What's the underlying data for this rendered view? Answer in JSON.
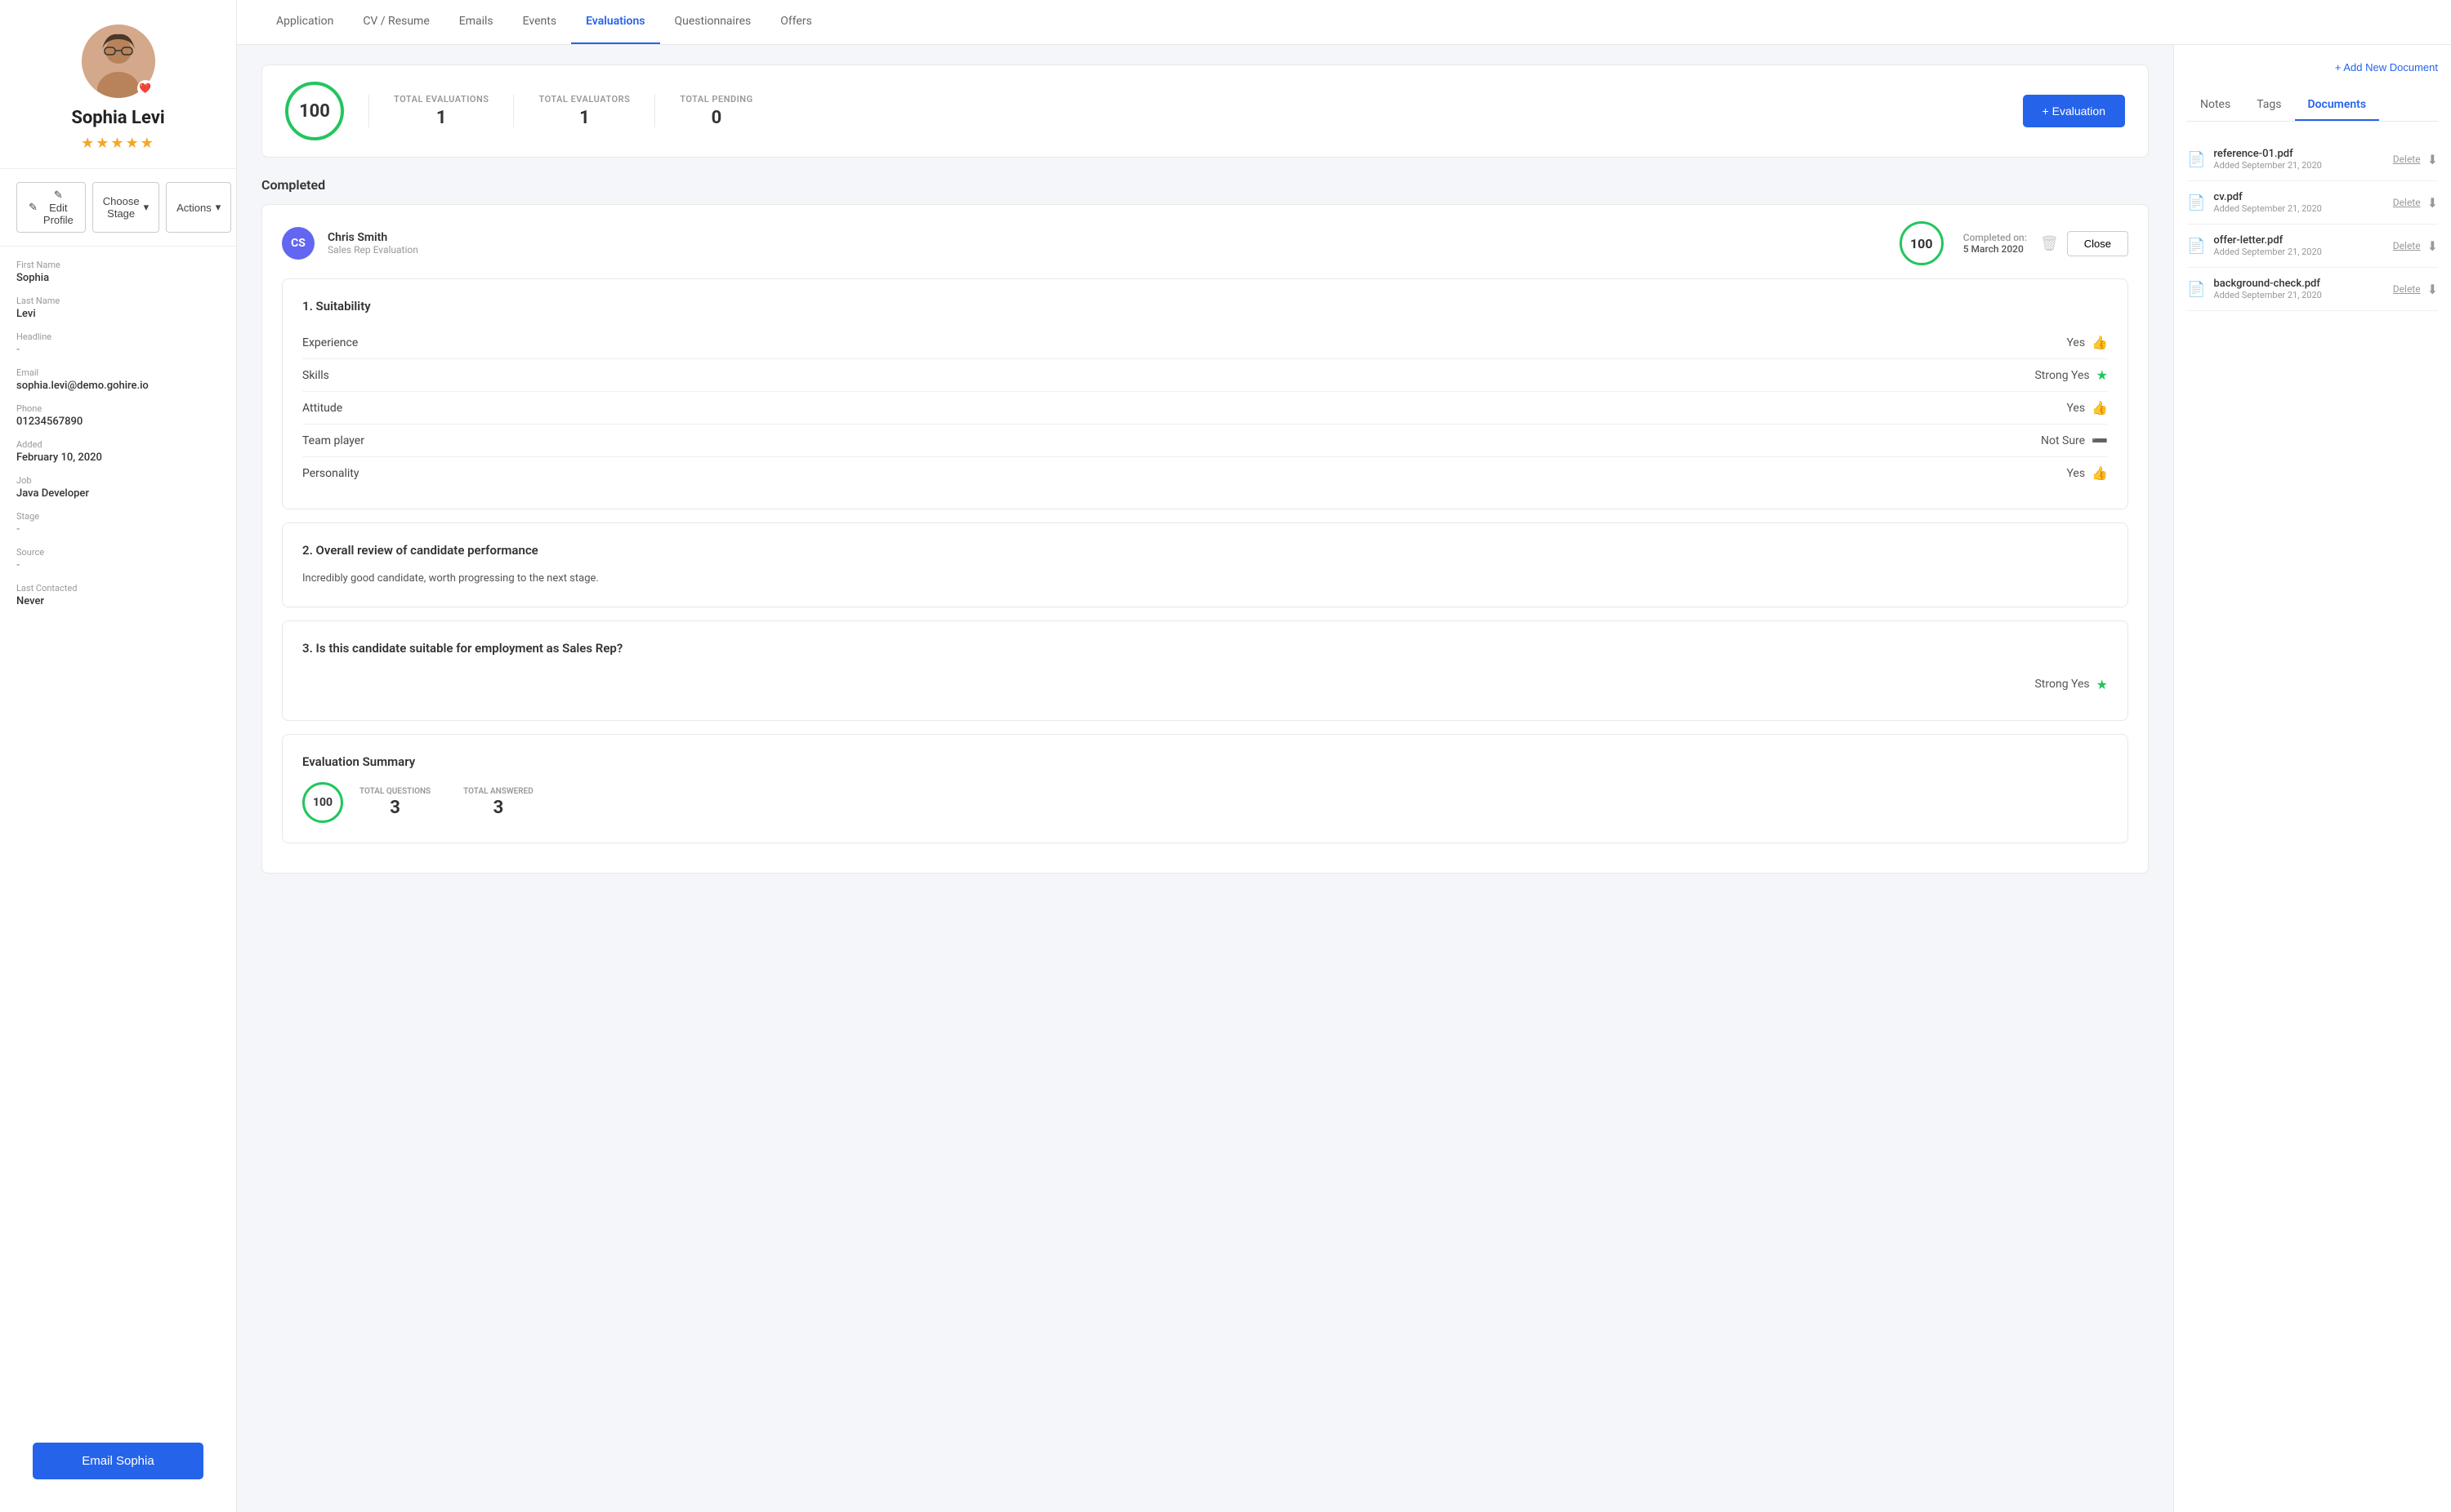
{
  "sidebar": {
    "candidate_name": "Sophia Levi",
    "stars": "★★★★★",
    "actions": {
      "edit_profile": "✎ Edit Profile",
      "choose_stage": "Choose Stage",
      "actions": "Actions"
    },
    "fields": [
      {
        "label": "First Name",
        "value": "Sophia",
        "empty": false
      },
      {
        "label": "Last Name",
        "value": "Levi",
        "empty": false
      },
      {
        "label": "Headline",
        "value": "-",
        "empty": true
      },
      {
        "label": "Email",
        "value": "sophia.levi@demo.gohire.io",
        "empty": false
      },
      {
        "label": "Phone",
        "value": "01234567890",
        "empty": false
      },
      {
        "label": "Added",
        "value": "February 10, 2020",
        "empty": false
      },
      {
        "label": "Job",
        "value": "Java Developer",
        "empty": false
      },
      {
        "label": "Stage",
        "value": "-",
        "empty": true
      },
      {
        "label": "Source",
        "value": "-",
        "empty": true
      },
      {
        "label": "Last Contacted",
        "value": "Never",
        "empty": false
      }
    ],
    "email_button": "Email Sophia"
  },
  "nav_tabs": [
    {
      "label": "Application",
      "active": false
    },
    {
      "label": "CV / Resume",
      "active": false
    },
    {
      "label": "Emails",
      "active": false
    },
    {
      "label": "Events",
      "active": false
    },
    {
      "label": "Evaluations",
      "active": true
    },
    {
      "label": "Questionnaires",
      "active": false
    },
    {
      "label": "Offers",
      "active": false
    }
  ],
  "stats": {
    "score": "100",
    "total_evaluations_label": "TOTAL EVALUATIONS",
    "total_evaluations_value": "1",
    "total_evaluators_label": "TOTAL EVALUATORS",
    "total_evaluators_value": "1",
    "total_pending_label": "TOTAL PENDING",
    "total_pending_value": "0",
    "add_evaluation_btn": "+ Evaluation"
  },
  "completed_section": {
    "title": "Completed",
    "evaluation": {
      "evaluator_initials": "CS",
      "evaluator_name": "Chris Smith",
      "evaluator_role": "Sales Rep Evaluation",
      "score": "100",
      "completed_label": "Completed on:",
      "completed_date": "5 March 2020",
      "close_btn": "Close"
    }
  },
  "questions": {
    "suitability": {
      "title": "1. Suitability",
      "rows": [
        {
          "question": "Experience",
          "answer": "Yes",
          "icon": "thumb"
        },
        {
          "question": "Skills",
          "answer": "Strong Yes",
          "icon": "star"
        },
        {
          "question": "Attitude",
          "answer": "Yes",
          "icon": "thumb"
        },
        {
          "question": "Team player",
          "answer": "Not Sure",
          "icon": "neutral"
        },
        {
          "question": "Personality",
          "answer": "Yes",
          "icon": "thumb"
        }
      ]
    },
    "overall_review": {
      "title": "2. Overall review of candidate performance",
      "text": "Incredibly good candidate, worth progressing to the next stage."
    },
    "suitability_q3": {
      "title": "3. Is this candidate suitable for employment as Sales Rep?",
      "answer": "Strong Yes",
      "icon": "star"
    },
    "summary": {
      "title": "Evaluation Summary",
      "score": "100",
      "total_questions_label": "TOTAL QUESTIONS",
      "total_questions_value": "3",
      "total_answered_label": "TOTAL ANSWERED",
      "total_answered_value": "3"
    }
  },
  "right_panel": {
    "tabs": [
      {
        "label": "Notes",
        "active": false
      },
      {
        "label": "Tags",
        "active": false
      },
      {
        "label": "Documents",
        "active": true
      }
    ],
    "add_document_btn": "+ Add New Document",
    "documents": [
      {
        "name": "reference-01.pdf",
        "date": "Added September 21, 2020"
      },
      {
        "name": "cv.pdf",
        "date": "Added September 21, 2020"
      },
      {
        "name": "offer-letter.pdf",
        "date": "Added September 21, 2020"
      },
      {
        "name": "background-check.pdf",
        "date": "Added September 21, 2020"
      }
    ],
    "delete_label": "Delete"
  }
}
